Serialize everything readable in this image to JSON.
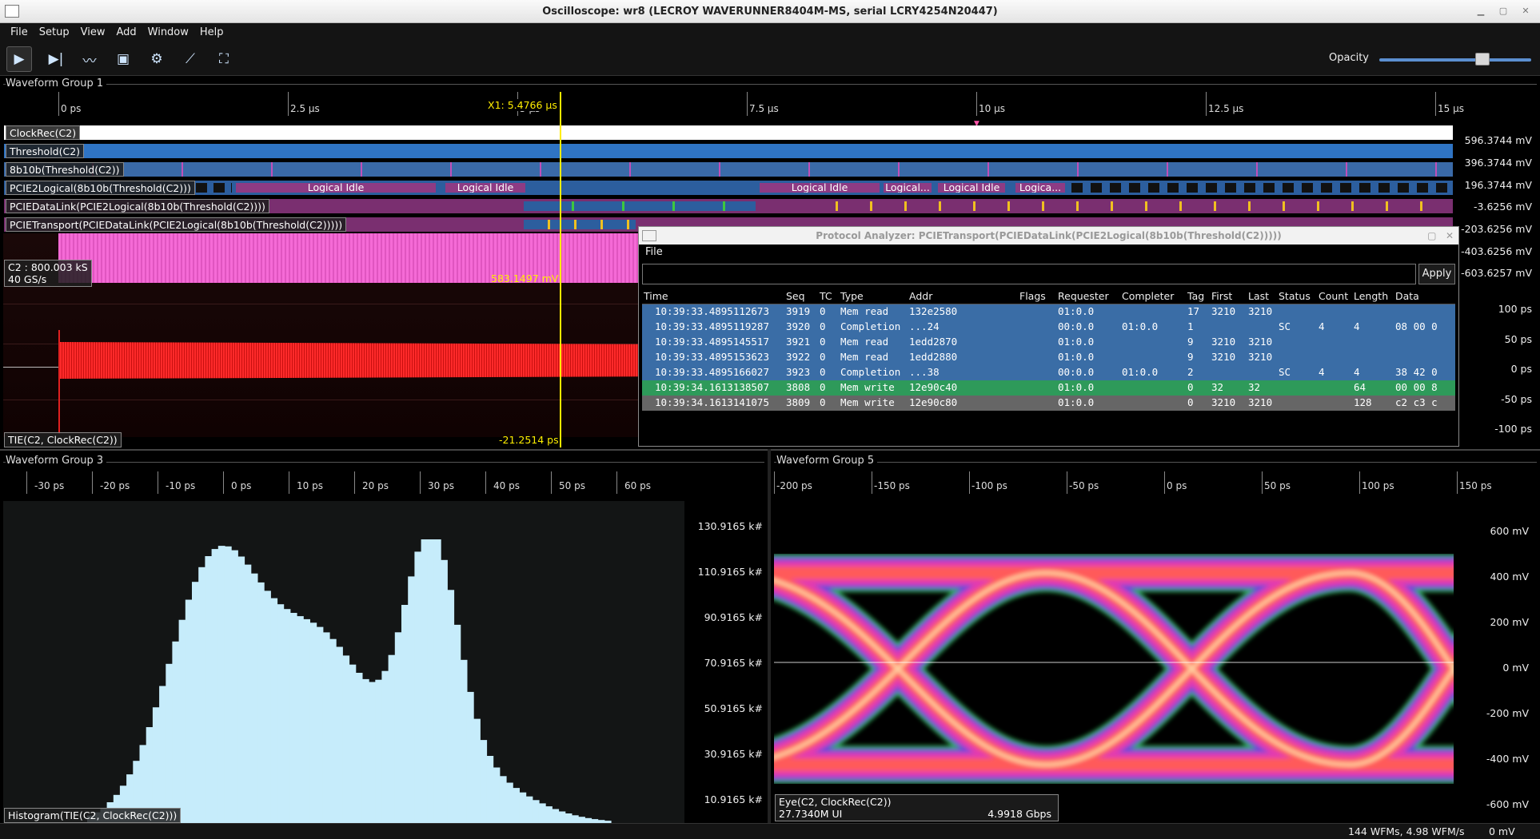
{
  "window": {
    "title": "Oscilloscope: wr8 (LECROY WAVERUNNER8404M-MS, serial LCRY4254N20447)"
  },
  "menu": [
    "File",
    "Setup",
    "View",
    "Add",
    "Window",
    "Help"
  ],
  "toolbar": {
    "opacity_label": "Opacity",
    "opacity_value": 0.8,
    "buttons": [
      "play-icon",
      "single-trigger-icon",
      "waveform-icon",
      "screenshot-icon",
      "settings-icon",
      "measure-icon",
      "fullscreen-icon"
    ]
  },
  "group1": {
    "label": "Waveform Group 1",
    "time_ticks": [
      "0 ps",
      "2.5 µs",
      "5 µs",
      "7.5 µs",
      "10 µs",
      "12.5 µs",
      "15 µs"
    ],
    "cursor_label": "X1: 5.4766 µs",
    "traces": [
      {
        "label": "ClockRec(C2)"
      },
      {
        "label": "Threshold(C2)"
      },
      {
        "label": "8b10b(Threshold(C2))"
      },
      {
        "label": "PCIE2Logical(8b10b(Threshold(C2)))"
      },
      {
        "label": "PCIEDataLink(PCIE2Logical(8b10b(Threshold(C2))))"
      },
      {
        "label": "PCIETransport(PCIEDataLink(PCIE2Logical(8b10b(Threshold(C2)))))"
      }
    ],
    "logical_segments": [
      "Logical Idle",
      "Logical Idle",
      "Logical Idle",
      "Logical...",
      "Logical Idle",
      "Logica..."
    ],
    "volt_scale": [
      "596.3744 mV",
      "396.3744 mV",
      "196.3744 mV",
      "-3.6256 mV",
      "-203.6256 mV",
      "-403.6256 mV",
      "-603.6257 mV"
    ],
    "c2_info": [
      "C2 : 800.003 kS",
      "40 GS/s"
    ],
    "c2_cursor_value": "583.1497 mV",
    "tie_label": "TIE(C2, ClockRec(C2))",
    "tie_cursor_value": "-21.2514 ps",
    "tie_scale": [
      "100 ps",
      "50 ps",
      "0 ps",
      "-50 ps",
      "-100 ps"
    ]
  },
  "protocol_analyzer": {
    "title": "Protocol Analyzer: PCIETransport(PCIEDataLink(PCIE2Logical(8b10b(Threshold(C2)))))",
    "menu": "File",
    "filter_value": "",
    "apply_label": "Apply",
    "columns": [
      "Time",
      "Seq",
      "TC",
      "Type",
      "Addr",
      "Flags",
      "Requester",
      "Completer",
      "Tag",
      "First",
      "Last",
      "Status",
      "Count",
      "Length",
      "Data"
    ],
    "rows": [
      {
        "time": "10:39:33.4895112673",
        "seq": "3919",
        "tc": "0",
        "type": "Mem read",
        "addr": "132e2580",
        "flags": "",
        "requester": "01:0.0",
        "completer": "",
        "tag": "17",
        "first": "3210",
        "last": "3210",
        "status": "",
        "count": "",
        "length": "",
        "data": "",
        "color": "#3a6da6"
      },
      {
        "time": "10:39:33.4895119287",
        "seq": "3920",
        "tc": "0",
        "type": "Completion",
        "addr": "...24",
        "flags": "",
        "requester": "00:0.0",
        "completer": "01:0.0",
        "tag": "1",
        "first": "",
        "last": "",
        "status": "SC",
        "count": "4",
        "length": "4",
        "data": "08 00 0",
        "color": "#3a6da6"
      },
      {
        "time": "10:39:33.4895145517",
        "seq": "3921",
        "tc": "0",
        "type": "Mem read",
        "addr": "1edd2870",
        "flags": "",
        "requester": "01:0.0",
        "completer": "",
        "tag": "9",
        "first": "3210",
        "last": "3210",
        "status": "",
        "count": "",
        "length": "",
        "data": "",
        "color": "#3a6da6"
      },
      {
        "time": "10:39:33.4895153623",
        "seq": "3922",
        "tc": "0",
        "type": "Mem read",
        "addr": "1edd2880",
        "flags": "",
        "requester": "01:0.0",
        "completer": "",
        "tag": "9",
        "first": "3210",
        "last": "3210",
        "status": "",
        "count": "",
        "length": "",
        "data": "",
        "color": "#3a6da6"
      },
      {
        "time": "10:39:33.4895166027",
        "seq": "3923",
        "tc": "0",
        "type": "Completion",
        "addr": "...38",
        "flags": "",
        "requester": "00:0.0",
        "completer": "01:0.0",
        "tag": "2",
        "first": "",
        "last": "",
        "status": "SC",
        "count": "4",
        "length": "4",
        "data": "38 42 0",
        "color": "#3a6da6"
      },
      {
        "time": "10:39:34.1613138507",
        "seq": "3808",
        "tc": "0",
        "type": "Mem write",
        "addr": "12e90c40",
        "flags": "",
        "requester": "01:0.0",
        "completer": "",
        "tag": "0",
        "first": "32",
        "last": "32",
        "status": "",
        "count": "",
        "length": "64",
        "data": "00 00 8",
        "color": "#2e9a5a"
      },
      {
        "time": "10:39:34.1613141075",
        "seq": "3809",
        "tc": "0",
        "type": "Mem write",
        "addr": "12e90c80",
        "flags": "",
        "requester": "01:0.0",
        "completer": "",
        "tag": "0",
        "first": "3210",
        "last": "3210",
        "status": "",
        "count": "",
        "length": "128",
        "data": "c2 c3 c",
        "color": "#666666"
      }
    ]
  },
  "group3": {
    "label": "Waveform Group 3",
    "x_ticks": [
      "-30 ps",
      "-20 ps",
      "-10 ps",
      "0 ps",
      "10 ps",
      "20 ps",
      "30 ps",
      "40 ps",
      "50 ps",
      "60 ps"
    ],
    "y_ticks": [
      "130.9165 k#",
      "110.9165 k#",
      "90.9165 k#",
      "70.9165 k#",
      "50.9165 k#",
      "30.9165 k#",
      "10.9165 k#"
    ],
    "trace_label": "Histogram(TIE(C2, ClockRec(C2)))",
    "bar_color": "#c6ecfb"
  },
  "group5": {
    "label": "Waveform Group 5",
    "x_ticks": [
      "-200 ps",
      "-150 ps",
      "-100 ps",
      "-50 ps",
      "0 ps",
      "50 ps",
      "100 ps",
      "150 ps"
    ],
    "y_ticks": [
      "600 mV",
      "400 mV",
      "200 mV",
      "0 mV",
      "-200 mV",
      "-400 mV",
      "-600 mV"
    ],
    "eye_label": "Eye(C2, ClockRec(C2))",
    "eye_ui": "27.7340M UI",
    "eye_rate": "4.9918 Gbps"
  },
  "status": {
    "wfm": "144 WFMs, 4.98 WFM/s",
    "value": "0 mV"
  }
}
